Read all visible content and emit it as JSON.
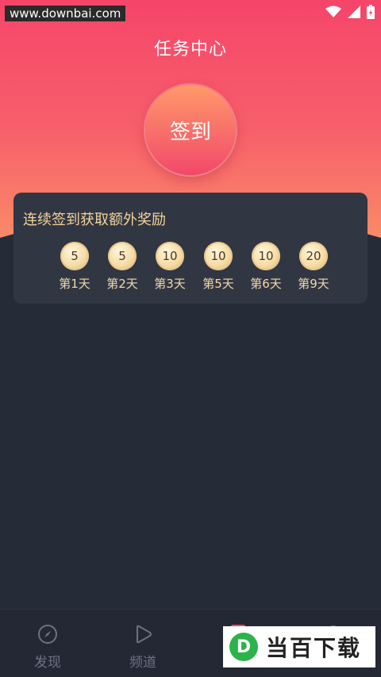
{
  "statusbar": {
    "watermark": "www.downbai.com",
    "icons": [
      "wifi-icon",
      "signal-icon",
      "battery-icon"
    ]
  },
  "header": {
    "title": "任务中心",
    "sign_button": "签到"
  },
  "rewards": {
    "title": "连续签到获取额外奖励",
    "days": [
      {
        "coins": "5",
        "label": "第1天"
      },
      {
        "coins": "5",
        "label": "第2天"
      },
      {
        "coins": "10",
        "label": "第3天"
      },
      {
        "coins": "10",
        "label": "第5天"
      },
      {
        "coins": "10",
        "label": "第6天"
      },
      {
        "coins": "20",
        "label": "第9天"
      }
    ]
  },
  "nav": {
    "items": [
      {
        "label": "发现",
        "icon": "compass-icon"
      },
      {
        "label": "频道",
        "icon": "play-icon"
      }
    ]
  },
  "brand": {
    "logo_letter": "D",
    "text": "当百下载"
  },
  "colors": {
    "hero_top": "#f5456a",
    "hero_bottom": "#f98a68",
    "background": "#262b38",
    "card": "#313643",
    "gold_text": "#f4d49a"
  }
}
